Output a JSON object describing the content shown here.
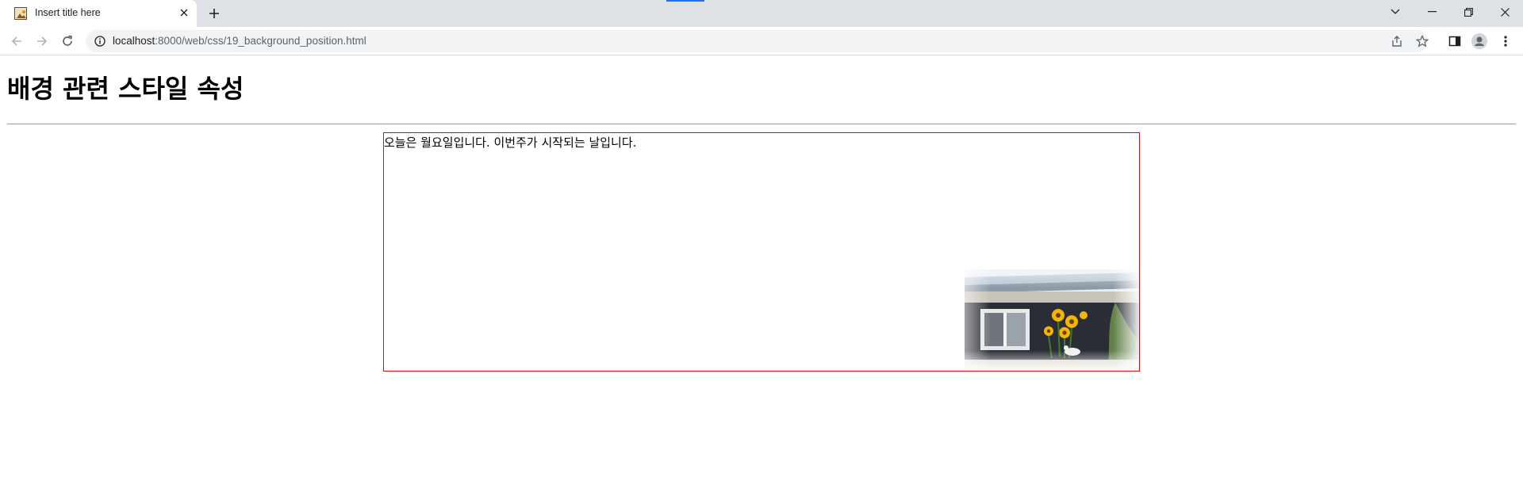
{
  "browser": {
    "tab": {
      "title": "Insert title here"
    },
    "url": {
      "host": "localhost",
      "path": ":8000/web/css/19_background_position.html"
    },
    "icons": {
      "favicon": "image-favicon",
      "close": "close-icon",
      "new_tab": "plus-icon",
      "tab_search": "chevron-down-icon",
      "minimize": "minimize-icon",
      "restore": "restore-icon",
      "window_close": "close-icon",
      "back": "arrow-left-icon",
      "forward": "arrow-right-icon",
      "reload": "reload-icon",
      "site_info": "info-icon",
      "share": "share-icon",
      "bookmark": "star-icon",
      "side_panel": "side-panel-icon",
      "profile": "profile-icon",
      "menu": "more-vert-icon"
    }
  },
  "page": {
    "heading": "배경 관련 스타일 속성",
    "box_text": "오늘은 월요일입니다. 이번주가 시작되는 날입니다.",
    "box_border_color": "#ff0000",
    "background_image": "house-wall-with-window-and-sunflowers"
  }
}
